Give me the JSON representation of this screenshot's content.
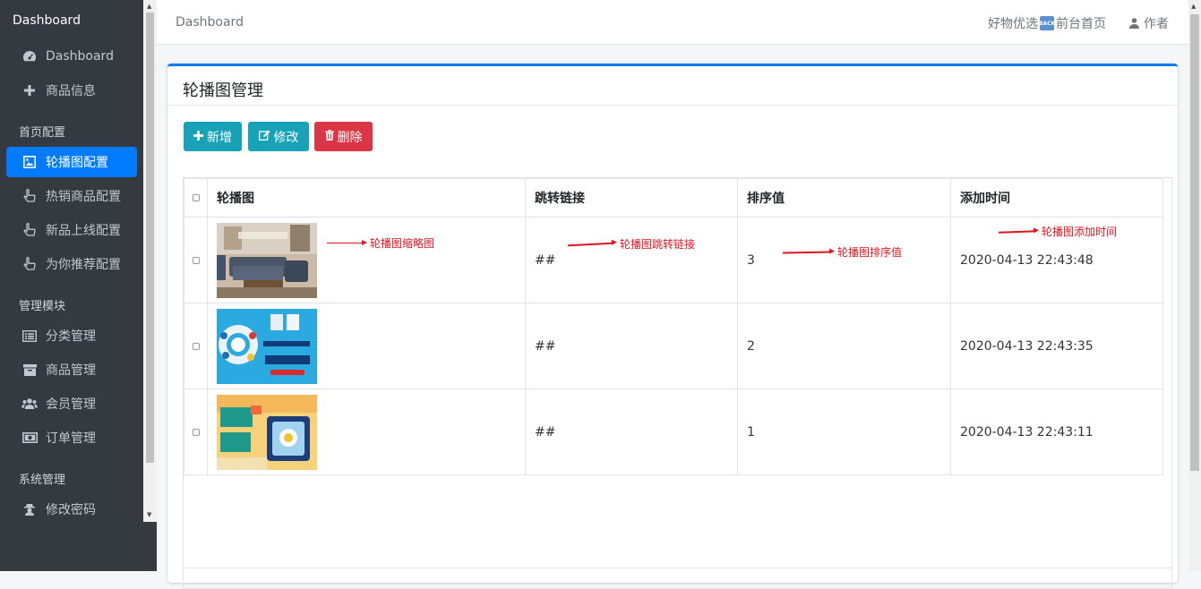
{
  "sidebar": {
    "brand": "Dashboard",
    "top_items": [
      {
        "label": "Dashboard",
        "icon": "tachometer-icon"
      },
      {
        "label": "商品信息",
        "icon": "plus-icon"
      }
    ],
    "sections": [
      {
        "header": "首页配置",
        "items": [
          {
            "label": "轮播图配置",
            "icon": "image-icon",
            "active": true
          },
          {
            "label": "热销商品配置",
            "icon": "hand-pointer-icon"
          },
          {
            "label": "新品上线配置",
            "icon": "hand-pointer-icon"
          },
          {
            "label": "为你推荐配置",
            "icon": "hand-pointer-icon"
          }
        ]
      },
      {
        "header": "管理模块",
        "items": [
          {
            "label": "分类管理",
            "icon": "list-alt-icon"
          },
          {
            "label": "商品管理",
            "icon": "archive-icon"
          },
          {
            "label": "会员管理",
            "icon": "users-icon"
          },
          {
            "label": "订单管理",
            "icon": "money-icon"
          }
        ]
      },
      {
        "header": "系统管理",
        "items": [
          {
            "label": "修改密码",
            "icon": "user-secret-icon"
          }
        ]
      }
    ]
  },
  "topbar": {
    "breadcrumb": "Dashboard",
    "link_mall": "好物优选",
    "link_home": "前台首页",
    "user": "作者"
  },
  "card": {
    "title": "轮播图管理",
    "buttons": {
      "add": "新增",
      "edit": "修改",
      "delete": "删除"
    }
  },
  "table": {
    "columns": [
      "轮播图",
      "跳转链接",
      "排序值",
      "添加时间"
    ],
    "rows": [
      {
        "link": "##",
        "rank": "3",
        "time": "2020-04-13 22:43:48"
      },
      {
        "link": "##",
        "rank": "2",
        "time": "2020-04-13 22:43:35"
      },
      {
        "link": "##",
        "rank": "1",
        "time": "2020-04-13 22:43:11"
      }
    ]
  },
  "annotations": {
    "thumb": "轮播图缩略图",
    "link": "轮播图跳转链接",
    "rank": "轮播图排序值",
    "time": "轮播图添加时间"
  },
  "colors": {
    "sidebar_bg": "#343a40",
    "active": "#007bff",
    "info": "#17a2b8",
    "danger": "#dc3545",
    "annotation": "#e0141e"
  }
}
